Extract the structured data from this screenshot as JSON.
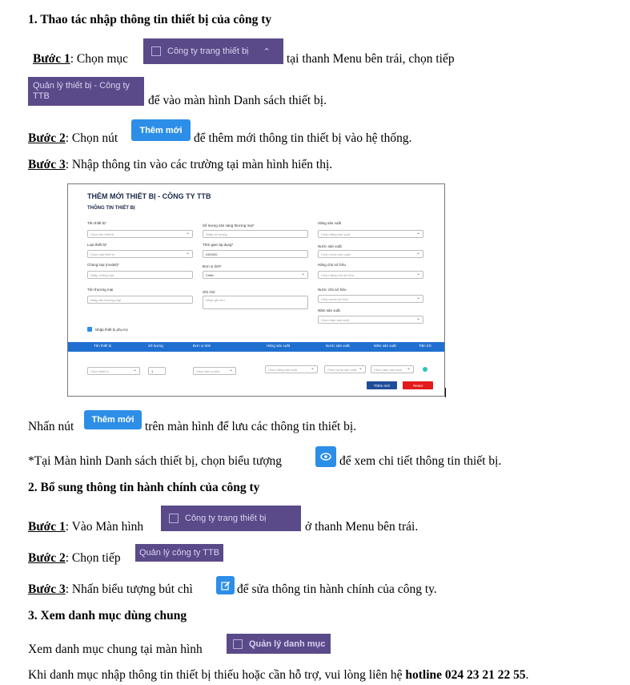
{
  "section1": {
    "heading": "1. Thao tác nhập thông tin thiết bị của công ty",
    "step1": {
      "label": "Bước 1",
      "text_a": ": Chọn mục ",
      "text_b": " tại thanh Menu bên trái, chọn tiếp",
      "text_c": " để vào màn hình Danh sách thiết bị.",
      "menu_chip": "Công ty trang thiết bị",
      "submenu_chip": "Quản lý thiết bị - Công ty TTB"
    },
    "step2": {
      "label": "Bước 2",
      "text_a": ": Chọn nút ",
      "text_b": " để thêm mới thông tin thiết bị vào hệ thống.",
      "button": "Thêm mới"
    },
    "step3": {
      "label": "Bước 3",
      "text": ": Nhập thông tin vào các trường tại màn hình hiển thị."
    },
    "save_note": {
      "text_a": "Nhấn nút ",
      "text_b": " trên màn hình để lưu các thông tin thiết bị.",
      "button": "Thêm mới"
    },
    "view_note": {
      "text_a": "*Tại Màn hình Danh sách thiết bị, chọn biểu tượng ",
      "text_b": " để xem chi tiết thông tin thiết bị."
    }
  },
  "form": {
    "title": "THÊM MỚI THIẾT BỊ - CÔNG TY TTB",
    "subtitle": "THÔNG TIN THIẾT BỊ",
    "fields": [
      {
        "label": "Tên thiết bị*",
        "placeholder": "Chọn tên thiết bị"
      },
      {
        "label": "Số lượng sản sàng thương mại*",
        "placeholder": "Nhập số lượng"
      },
      {
        "label": "Hãng sản xuất",
        "placeholder": "Chọn hãng sản xuất"
      },
      {
        "label": "Loại thiết bị*",
        "placeholder": "Chọn loại thiết bị"
      },
      {
        "label": "Thời gian áp dụng*",
        "placeholder": "03/2020"
      },
      {
        "label": "Nước sản xuất",
        "placeholder": "Chọn nước sản xuất"
      },
      {
        "label": "Chủng loại (model)*",
        "placeholder": "Nhập chủng loại"
      },
      {
        "label": "Đơn vị tính*",
        "placeholder": "Chiếc"
      },
      {
        "label": "Hãng chủ sở hữu",
        "placeholder": "Chọn hãng chủ sở hữu"
      },
      {
        "label": "Tên thương mại",
        "placeholder": "Nhập tên thương mại"
      },
      {
        "label": "Ghi chú",
        "placeholder": "Nhập ghi chú"
      },
      {
        "label": "Nước chủ sở hữu",
        "placeholder": "Chọn nước sở hữu"
      },
      {
        "label": "Năm sản xuất",
        "placeholder": "Chọn năm sản xuất"
      }
    ],
    "checkbox": "Nhập thiết bị phụ trợ",
    "table_headers": [
      "Tên thiết bị",
      "Số lượng",
      "Đơn vị tính",
      "Hãng sản xuất",
      "Nước sản xuất",
      "Năm sản xuất",
      "Tiện ích"
    ],
    "row": {
      "device": "Chọn thiết bị",
      "qty": "1",
      "unit": "Chọn đơn vị tính",
      "maker": "Chọn hãng sản xuất",
      "country": "Chọn nước sản xuất",
      "year": "Chọn năm sản xuất"
    },
    "add_button": "Thêm mới",
    "reset_button": "Reset"
  },
  "section2": {
    "heading": "2. Bổ sung thông tin hành chính của công ty",
    "step1": {
      "label": "Bước 1",
      "text_a": ": Vào Màn hình ",
      "text_b": " ở thanh Menu bên trái.",
      "menu_chip": "Công ty trang thiết bị"
    },
    "step2": {
      "label": "Bước 2",
      "text_a": ": Chọn tiếp ",
      "submenu_chip": "Quản lý công ty TTB"
    },
    "step3": {
      "label": "Bước 3",
      "text_a": ": Nhấn biểu tượng bút chì ",
      "text_b": " để sửa thông tin hành chính của công ty."
    }
  },
  "section3": {
    "heading": "3. Xem danh mục dùng chung",
    "text_a": "Xem danh mục chung tại màn hình ",
    "menu_chip": "Quản lý danh mục",
    "contact_a": "Khi danh mục nhập thông tin thiết bị thiếu hoặc cần hỗ trợ, vui lòng liên hệ ",
    "hotline": "hotline 024 23 21 22 55",
    "contact_end": "."
  }
}
